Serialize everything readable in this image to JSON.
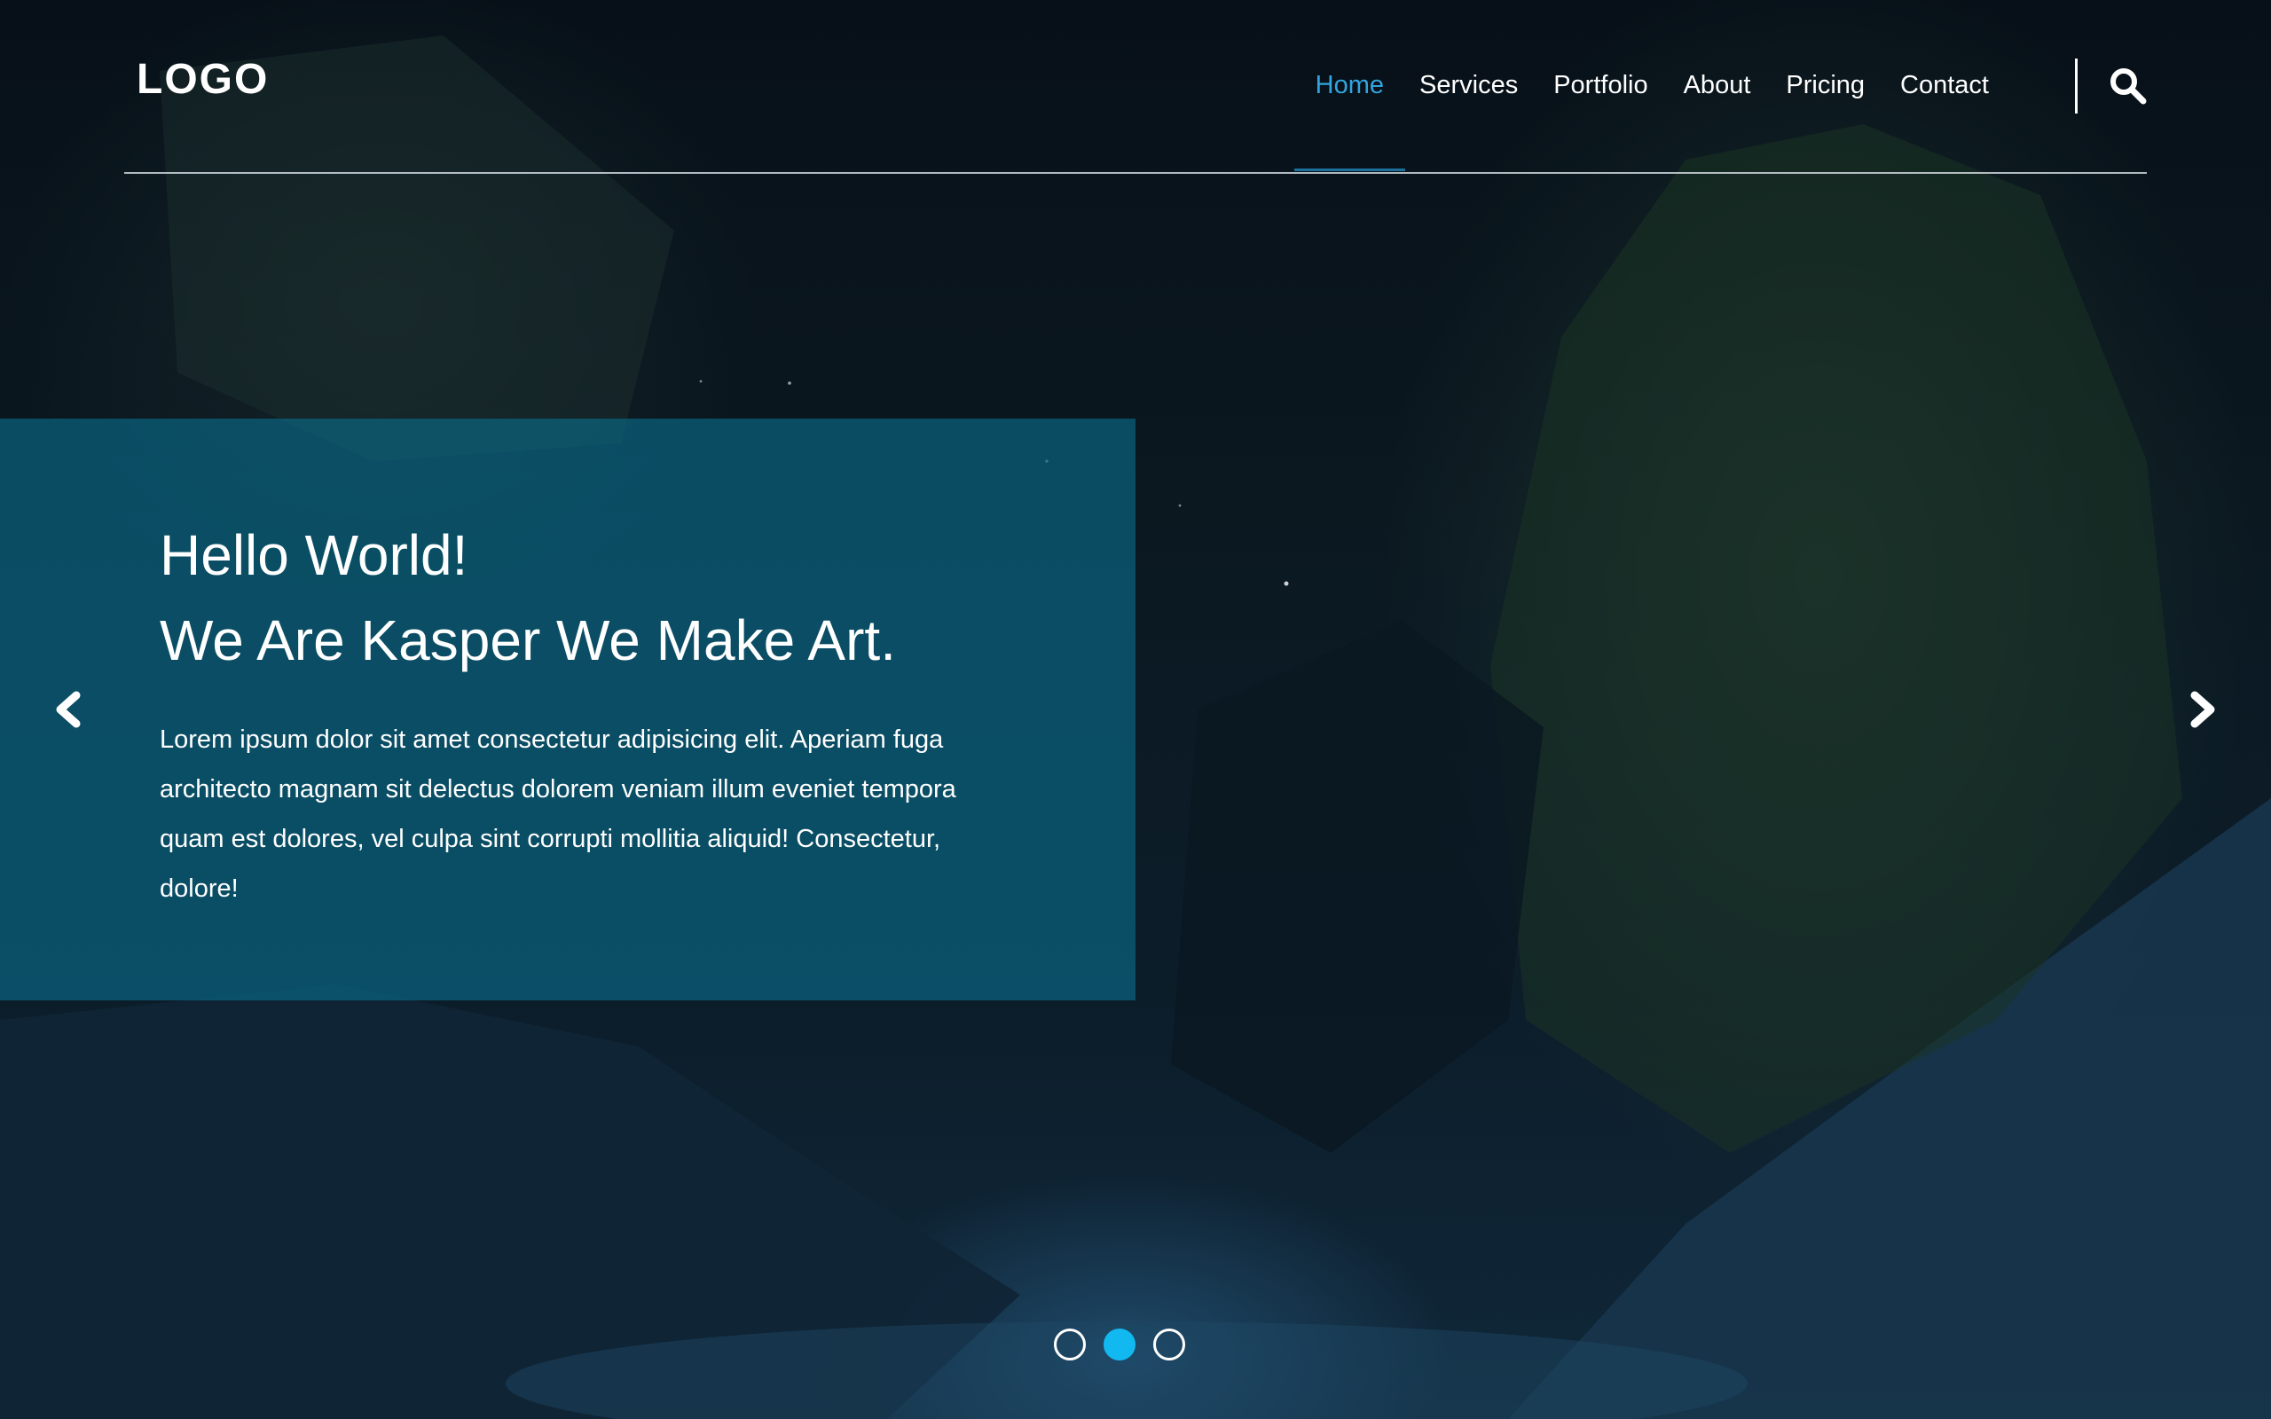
{
  "header": {
    "logo": "LOGO",
    "nav": [
      {
        "label": "Home",
        "active": true
      },
      {
        "label": "Services",
        "active": false
      },
      {
        "label": "Portfolio",
        "active": false
      },
      {
        "label": "About",
        "active": false
      },
      {
        "label": "Pricing",
        "active": false
      },
      {
        "label": "Contact",
        "active": false
      }
    ],
    "search_icon": "search-icon"
  },
  "slider": {
    "heading_line1": "Hello World!",
    "heading_line2": "We Are Kasper We Make Art.",
    "body": "Lorem ipsum dolor sit amet consectetur adipisicing elit. Aperiam fuga architecto magnam sit delectus dolorem veniam illum eveniet tempora quam est dolores, vel culpa sint corrupti mollitia aliquid! Consectetur, dolore!",
    "prev_icon": "chevron-left-icon",
    "next_icon": "chevron-right-icon",
    "slide_count": 3,
    "active_slide": 2
  },
  "colors": {
    "accent": "#33a4e0",
    "active_dot": "#12b8f0",
    "caption_bg": "#0a6e8c"
  }
}
